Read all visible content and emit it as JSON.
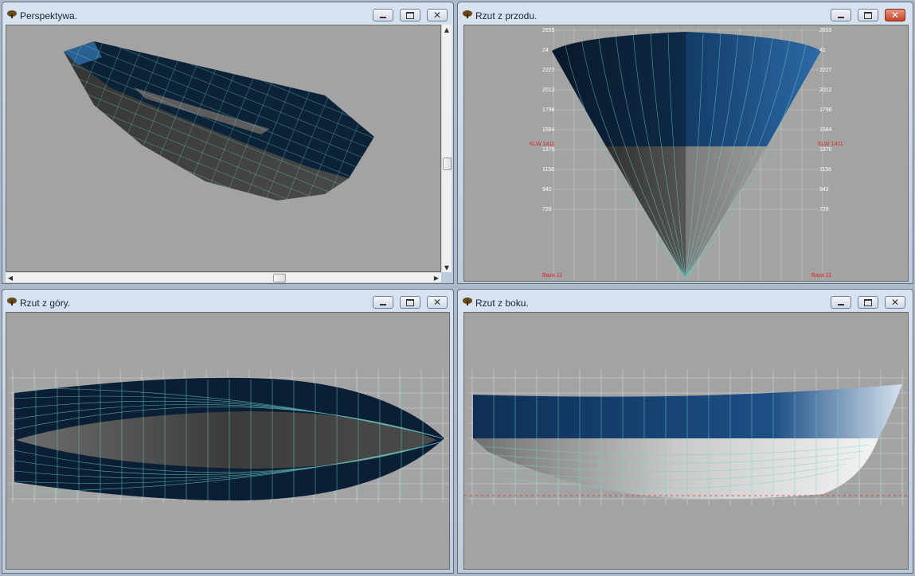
{
  "windows": {
    "perspective": {
      "title": "Perspektywa."
    },
    "front": {
      "title": "Rzut z przodu.",
      "left_labels": [
        "2655",
        "24",
        "2227",
        "2012",
        "1798",
        "1584",
        "1370",
        "1156",
        "942",
        "728"
      ],
      "right_labels": [
        "2655",
        "41",
        "2227",
        "2012",
        "1798",
        "1584",
        "1370",
        "1156",
        "942",
        "728"
      ],
      "waterline_label": "KLW 1411",
      "base_label": "Baza 11"
    },
    "top": {
      "title": "Rzut z góry."
    },
    "side": {
      "title": "Rzut z boku."
    }
  },
  "colors": {
    "hull_dark": "#0a1f36",
    "hull_blue": "#1f4f80",
    "grid": "#6fd5c6",
    "bg": "#a3a3a3",
    "red_label": "#e02020"
  }
}
